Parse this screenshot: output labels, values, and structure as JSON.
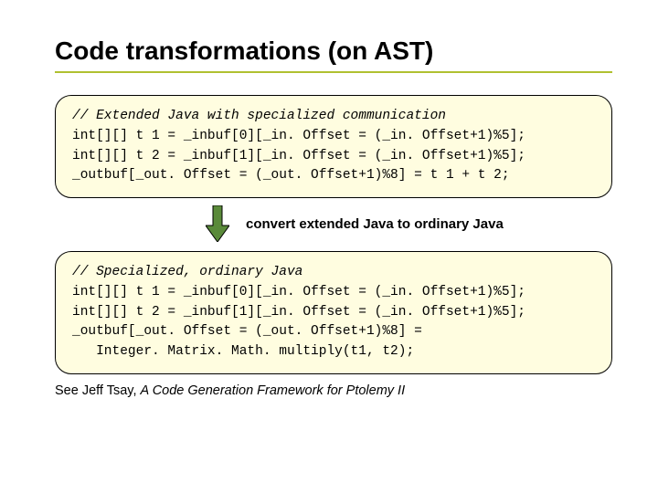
{
  "title": "Code transformations (on AST)",
  "box1": {
    "comment": "// Extended Java with specialized communication",
    "l1": "int[][] t 1 = _inbuf[0][_in. Offset = (_in. Offset+1)%5];",
    "l2": "int[][] t 2 = _inbuf[1][_in. Offset = (_in. Offset+1)%5];",
    "l3": "_outbuf[_out. Offset = (_out. Offset+1)%8] = t 1 + t 2;"
  },
  "arrow_label": "convert extended Java to ordinary Java",
  "box2": {
    "comment": "// Specialized, ordinary Java",
    "l1": "int[][] t 1 = _inbuf[0][_in. Offset = (_in. Offset+1)%5];",
    "l2": "int[][] t 2 = _inbuf[1][_in. Offset = (_in. Offset+1)%5];",
    "l3": "_outbuf[_out. Offset = (_out. Offset+1)%8] =",
    "l4": "   Integer. Matrix. Math. multiply(t1, t2);"
  },
  "footnote": {
    "prefix": "See ",
    "author": "Jeff Tsay",
    "sep": ", ",
    "work": "A Code Generation Framework for Ptolemy II"
  }
}
